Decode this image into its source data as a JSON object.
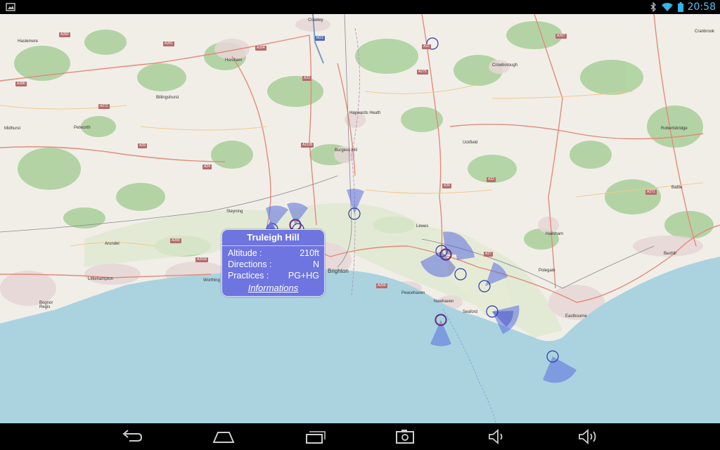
{
  "status_bar": {
    "time": "20:58",
    "icons": [
      "image-icon",
      "bluetooth-icon",
      "wifi-icon",
      "battery-icon"
    ]
  },
  "map": {
    "places": [
      {
        "name": "Crawley"
      },
      {
        "name": "Haslemere"
      },
      {
        "name": "Horsham"
      },
      {
        "name": "Billingshurst"
      },
      {
        "name": "Midhurst"
      },
      {
        "name": "Petworth"
      },
      {
        "name": "Haywards Heath"
      },
      {
        "name": "Burgess Hill"
      },
      {
        "name": "Crowborough"
      },
      {
        "name": "Uckfield"
      },
      {
        "name": "Cranbrook"
      },
      {
        "name": "Robertsbridge"
      },
      {
        "name": "Battle"
      },
      {
        "name": "Steyning"
      },
      {
        "name": "Arundel"
      },
      {
        "name": "Littlehampton"
      },
      {
        "name": "Worthing"
      },
      {
        "name": "Brighton"
      },
      {
        "name": "Lewes"
      },
      {
        "name": "Peacehaven"
      },
      {
        "name": "Newhaven"
      },
      {
        "name": "Seaford"
      },
      {
        "name": "Hailsham"
      },
      {
        "name": "Polegate"
      },
      {
        "name": "Eastbourne"
      },
      {
        "name": "Bexhill"
      },
      {
        "name": "Bognor Regis"
      }
    ],
    "roads": [
      "A283",
      "A281",
      "A264",
      "M23",
      "A22",
      "A267",
      "A286",
      "A272",
      "A29",
      "A23",
      "A275",
      "A26",
      "A2100",
      "A27",
      "A259",
      "A24",
      "A280",
      "A2032",
      "A271",
      "A22"
    ]
  },
  "popup": {
    "title": "Truleigh Hill",
    "rows": [
      {
        "key": "Altitude :",
        "value": "210ft"
      },
      {
        "key": "Directions :",
        "value": "N"
      },
      {
        "key": "Practices :",
        "value": "PG+HG"
      }
    ],
    "link": "Informations"
  },
  "nav_bar": {
    "buttons": [
      "back-icon",
      "home-icon",
      "recent-apps-icon",
      "screenshot-icon",
      "volume-down-icon",
      "volume-up-icon"
    ]
  }
}
